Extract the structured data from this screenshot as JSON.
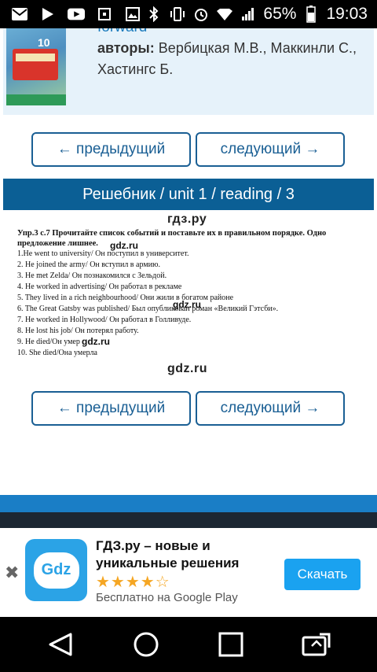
{
  "status_bar": {
    "battery": "65%",
    "time": "19:03"
  },
  "book": {
    "title_partial": "forward",
    "authors_label": "авторы:",
    "authors": "Вербицкая М.В., Маккинли С., Хастингс Б.",
    "cover_number": "10"
  },
  "nav": {
    "prev_label": "← предыдущий",
    "next_label": "следующий →"
  },
  "breadcrumb": "Решебник / unit 1 / reading / 3",
  "site_label_top": "гдз.ру",
  "site_label_bottom": "gdz.ru",
  "exercise": {
    "header": "Упр.3 с.7 Прочитайте список событий и поставьте их в правильном порядке. Одно предложение лишнее.",
    "lines": [
      "1.He went to university/ Он поступил в университет.",
      "2. He joined the army/ Он вступил в армию.",
      "3. He met Zelda/ Он познакомился с Зельдой.",
      "4. He worked in advertising/ Он работал в рекламе",
      "5. They lived in a rich neighbourhood/ Они жили в богатом районе",
      "6. The Great Gatsby was published/ Был опубликован роман «Великий Гэтсби».",
      "7. He worked in Hollywood/ Он работал в Голливуде.",
      "8. He lost his job/ Он потерял работу.",
      "9. He died/Он умер",
      "10. She died/Она умерла"
    ],
    "watermark": "gdz.ru"
  },
  "ad": {
    "icon_text": "Gdz",
    "title": "ГДЗ.ру – новые и уникальные решения",
    "rating": 4.5,
    "stars": "★★★★☆",
    "subtitle": "Бесплатно на Google Play",
    "button_label": "Скачать",
    "close_glyph": "✖"
  },
  "colors": {
    "primary": "#0b5f95",
    "accent": "#1a7ec6",
    "ad_button": "#1aa2f0",
    "star": "#f5a623"
  },
  "icons": [
    "mail-icon",
    "play-icon",
    "youtube-icon",
    "square-icon",
    "photo-icon",
    "bluetooth-icon",
    "vibrate-icon",
    "alarm-icon",
    "wifi-icon",
    "signal-icon",
    "battery-icon",
    "back-icon",
    "home-icon",
    "recents-icon",
    "switch-icon"
  ]
}
